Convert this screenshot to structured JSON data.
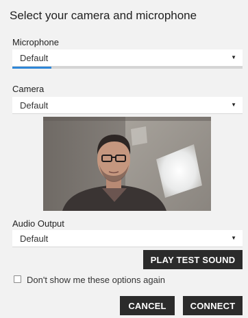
{
  "dialog": {
    "title": "Select your camera and microphone"
  },
  "microphone": {
    "label": "Microphone",
    "selected": "Default",
    "arrow_icon": "triangle-down-icon",
    "input_level": 0.17,
    "level_color": "#2d86d8"
  },
  "camera": {
    "label": "Camera",
    "selected": "Default",
    "arrow_icon": "triangle-down-icon"
  },
  "audio_output": {
    "label": "Audio Output",
    "selected": "Default",
    "arrow_icon": "triangle-down-icon",
    "test_button_label": "PLAY TEST SOUND"
  },
  "options": {
    "dont_show_label": "Don't show me these options again",
    "dont_show_checked": false
  },
  "actions": {
    "cancel_label": "CANCEL",
    "connect_label": "CONNECT"
  }
}
